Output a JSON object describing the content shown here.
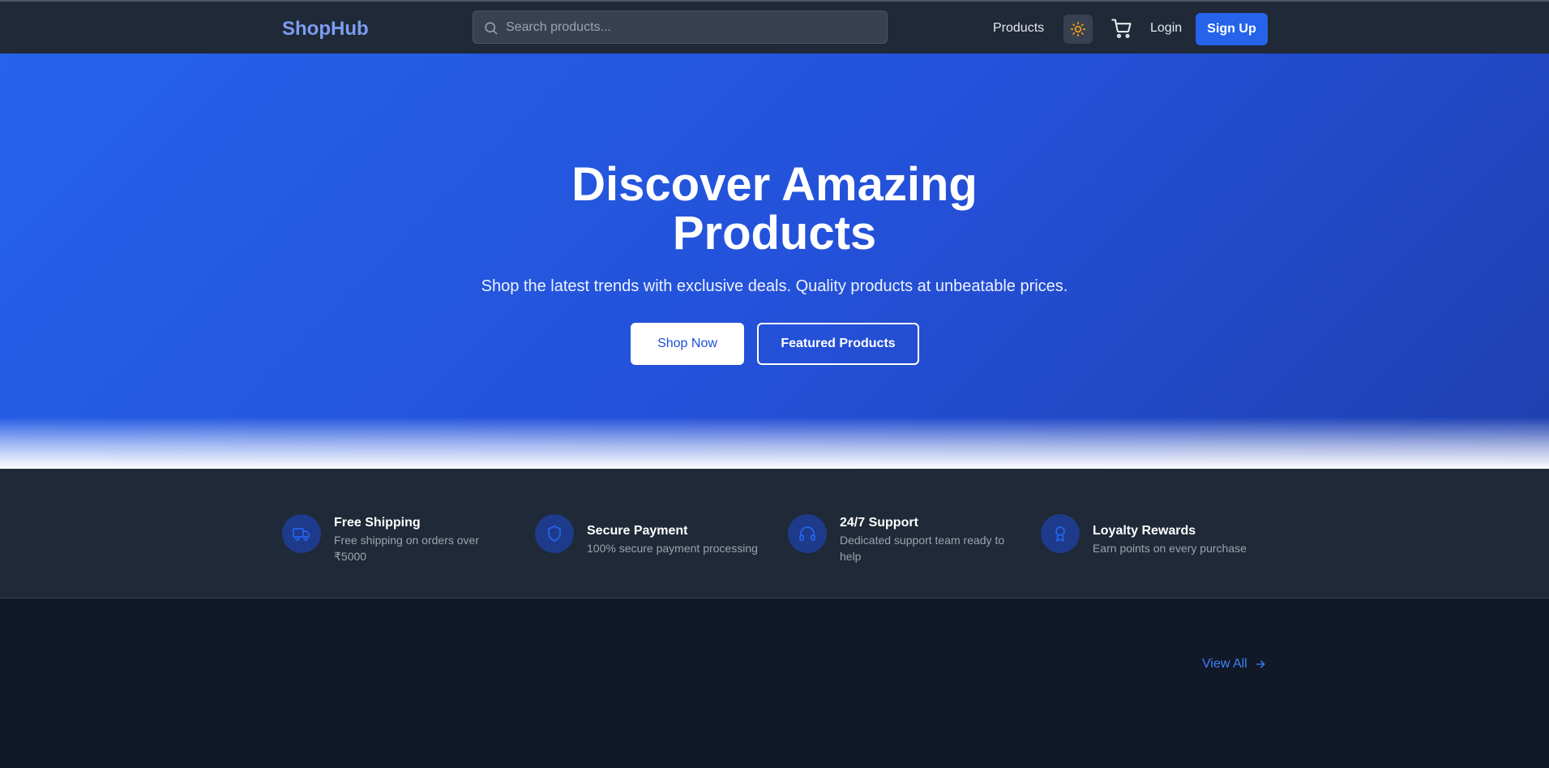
{
  "header": {
    "logo": "ShopHub",
    "search_placeholder": "Search products...",
    "nav_products": "Products",
    "login": "Login",
    "signup": "Sign Up"
  },
  "hero": {
    "title_line1": "Discover Amazing",
    "title_line2": "Products",
    "subtitle": "Shop the latest trends with exclusive deals. Quality products at unbeatable prices.",
    "shop_now": "Shop Now",
    "featured_products": "Featured Products"
  },
  "features": [
    {
      "title": "Free Shipping",
      "desc": "Free shipping on orders over ₹5000",
      "icon": "truck-icon"
    },
    {
      "title": "Secure Payment",
      "desc": "100% secure payment processing",
      "icon": "shield-icon"
    },
    {
      "title": "24/7 Support",
      "desc": "Dedicated support team ready to help",
      "icon": "headphones-icon"
    },
    {
      "title": "Loyalty Rewards",
      "desc": "Earn points on every purchase",
      "icon": "award-icon"
    }
  ],
  "section": {
    "view_all": "View All"
  },
  "colors": {
    "brand": "#2563eb",
    "logo": "#7c9cf0",
    "navbar": "#1f2937",
    "page_bg": "#111827",
    "theme_icon": "#f59e0b"
  }
}
